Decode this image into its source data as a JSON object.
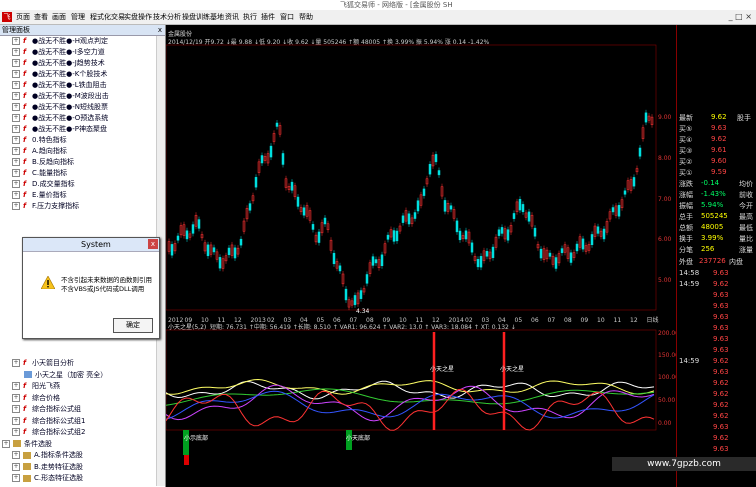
{
  "window": {
    "title": "飞狐交易师 - 网络版 - [金属股份 SH"
  },
  "menu": {
    "items": [
      "页面",
      "查看",
      "画面",
      "管理",
      "程式化交易",
      "实盘操作",
      "技术分析",
      "操盘训练基地",
      "资讯",
      "执行",
      "插件",
      "窗口",
      "帮助"
    ]
  },
  "left_panel": {
    "title": "管理面板",
    "close_label": "x",
    "items": [
      {
        "label": "●战无不胜●-H观点判定",
        "type": "formula"
      },
      {
        "label": "●战无不胜●-I多空力道",
        "type": "formula"
      },
      {
        "label": "●战无不胜●-J趋势技术",
        "type": "formula"
      },
      {
        "label": "●战无不胜●-K个股技术",
        "type": "formula"
      },
      {
        "label": "●战无不胜●-L铁血阻击",
        "type": "formula"
      },
      {
        "label": "●战无不胜●-M波段出击",
        "type": "formula"
      },
      {
        "label": "●战无不胜●-N短线股票",
        "type": "formula"
      },
      {
        "label": "●战无不胜●-O预选系统",
        "type": "formula"
      },
      {
        "label": "●战无不胜●-P神态聚盘",
        "type": "formula"
      },
      {
        "label": "0.特色指标",
        "type": "formula"
      },
      {
        "label": "A.趋向指标",
        "type": "formula"
      },
      {
        "label": "B.反趋向指标",
        "type": "formula"
      },
      {
        "label": "C.能量指标",
        "type": "formula"
      },
      {
        "label": "D.成交量指标",
        "type": "formula"
      },
      {
        "label": "E.量价指标",
        "type": "formula"
      },
      {
        "label": "F.压力支撑指标",
        "type": "formula"
      },
      {
        "label": "小天箭目分析",
        "type": "formula"
      },
      {
        "label": "小天之星（加密 亮全）",
        "type": "sub"
      },
      {
        "label": "阳光飞燕",
        "type": "formula"
      },
      {
        "label": "综合价格",
        "type": "formula"
      },
      {
        "label": "综合指标公式组",
        "type": "formula"
      },
      {
        "label": "综合指标公式组1",
        "type": "formula"
      },
      {
        "label": "综合指标公式组2",
        "type": "formula"
      },
      {
        "label": "条件选股",
        "type": "group"
      },
      {
        "label": "A.指标条件选股",
        "type": "folder"
      },
      {
        "label": "B.走势特征选股",
        "type": "folder"
      },
      {
        "label": "C.形态特征选股",
        "type": "folder"
      }
    ]
  },
  "dialog": {
    "title": "System",
    "close": "x",
    "line1": "不含引起未来数据的函数则引用",
    "line2": "不含VBS或JS代码或DLL调用",
    "ok_label": "确定"
  },
  "chart_header": {
    "tab": "金属股份",
    "info": "2014/12/19 开9.72 ↓最 9.88 ↓低 9.20 ↓收 9.62 ↓量 505246 ↑额 48005 ↑换 3.99% 振 5.94% 涨 0.14 -1.42%"
  },
  "price_axis": [
    "9.00",
    "8.00",
    "7.00",
    "6.00",
    "5.00"
  ],
  "time_axis": [
    "2012",
    "09",
    "10",
    "11",
    "12",
    "2013",
    "02",
    "03",
    "04",
    "05",
    "06",
    "07",
    "08",
    "09",
    "10",
    "11",
    "12",
    "2014",
    "02",
    "03",
    "04",
    "05",
    "06",
    "07",
    "08",
    "09",
    "10",
    "11",
    "12",
    "日线"
  ],
  "low_label": "4.34",
  "indicator": {
    "title": "小天之星(5,2)",
    "values": "短期: 76.731 ↑中期: 56.419 ↑长期: 8.510 ↑ VAR1: 96.624 ↑ VAR2: 13.0 ↑ VAR3: 18.084 ↑ XT: 0.132 ↓",
    "axis": [
      "200.00",
      "150.00",
      "100.00",
      "50.00",
      "0.00"
    ],
    "star_labels": [
      "小天之星",
      "小天之星"
    ],
    "bottom_labels": [
      "小示底部",
      "小天底部"
    ]
  },
  "quote": {
    "latest_label": "最新",
    "latest": "9.62",
    "unit": "股手",
    "buy": [
      {
        "l": "买⑤",
        "v": "9.63"
      },
      {
        "l": "买④",
        "v": "9.62"
      },
      {
        "l": "买③",
        "v": "9.61"
      },
      {
        "l": "买②",
        "v": "9.60"
      },
      {
        "l": "买①",
        "v": "9.59"
      }
    ],
    "stats_left": [
      {
        "l": "涨跌",
        "v": "-0.14"
      },
      {
        "l": "涨幅",
        "v": "-1.43%"
      },
      {
        "l": "振幅",
        "v": "5.94%"
      },
      {
        "l": "总手",
        "v": "505245"
      },
      {
        "l": "总额",
        "v": "48005"
      },
      {
        "l": "换手",
        "v": "3.99%"
      },
      {
        "l": "分笔",
        "v": "256"
      }
    ],
    "stats_right": [
      "均价",
      "前收",
      "今开",
      "最高",
      "最低",
      "量比",
      "涨量"
    ],
    "outer_label": "外盘",
    "outer": "237726",
    "inner_label": "内盘",
    "ticks": [
      {
        "t": "14:58",
        "p": "9.63"
      },
      {
        "t": "14:59",
        "p": "9.62"
      },
      {
        "t": "",
        "p": "9.63"
      },
      {
        "t": "",
        "p": "9.63"
      },
      {
        "t": "",
        "p": "9.63"
      },
      {
        "t": "",
        "p": "9.63"
      },
      {
        "t": "",
        "p": "9.63"
      },
      {
        "t": "",
        "p": "9.63"
      },
      {
        "t": "14:59",
        "p": "9.62"
      },
      {
        "t": "",
        "p": "9.63"
      },
      {
        "t": "",
        "p": "9.62"
      },
      {
        "t": "",
        "p": "9.62"
      },
      {
        "t": "",
        "p": "9.62"
      },
      {
        "t": "",
        "p": "9.62"
      },
      {
        "t": "",
        "p": "9.63"
      },
      {
        "t": "",
        "p": "9.62"
      },
      {
        "t": "",
        "p": "9.63"
      },
      {
        "t": "",
        "p": "9.63"
      }
    ]
  },
  "watermark": "www.7gpzb.com",
  "colors": {
    "up": "#ff3333",
    "down": "#00ffff",
    "yellow": "#ffff00",
    "bg": "#000000"
  }
}
